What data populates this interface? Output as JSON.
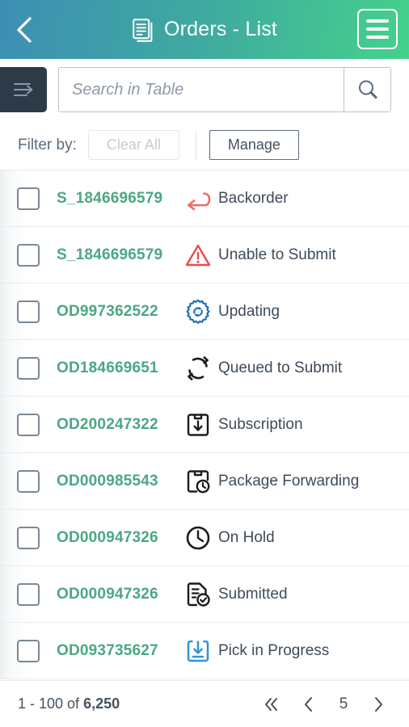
{
  "header": {
    "title": "Orders - List",
    "back_icon": "chevron-left-icon",
    "title_icon": "documents-icon",
    "menu_icon": "hamburger-menu-icon",
    "gradient_start": "#3d8fb4",
    "gradient_end": "#45d18c"
  },
  "toolbar": {
    "panel_toggle_icon": "expand-panel-icon",
    "search_placeholder": "Search in Table",
    "search_value": "",
    "search_icon": "search-icon"
  },
  "filters": {
    "label": "Filter by:",
    "clear_all_label": "Clear All",
    "clear_all_disabled": true,
    "manage_label": "Manage"
  },
  "list": {
    "rows": [
      {
        "order_id": "S_1846696579",
        "status": "Backorder",
        "icon": "backorder-arrow-icon",
        "icon_color": "#ef6b66"
      },
      {
        "order_id": "S_1846696579",
        "status": "Unable to Submit",
        "icon": "warning-triangle-icon",
        "icon_color": "#ef4a4a"
      },
      {
        "order_id": "OD997362522",
        "status": "Updating",
        "icon": "gear-refresh-icon",
        "icon_color": "#1c6cb5"
      },
      {
        "order_id": "OD184669651",
        "status": "Queued to Submit",
        "icon": "refresh-arrows-icon",
        "icon_color": "#1b1b1b"
      },
      {
        "order_id": "OD200247322",
        "status": "Subscription",
        "icon": "box-download-icon",
        "icon_color": "#1b1b1b"
      },
      {
        "order_id": "OD000985543",
        "status": "Package Forwarding",
        "icon": "box-clock-icon",
        "icon_color": "#1b1b1b"
      },
      {
        "order_id": "OD000947326",
        "status": "On Hold",
        "icon": "clock-icon",
        "icon_color": "#1b1b1b"
      },
      {
        "order_id": "OD000947326",
        "status": "Submitted",
        "icon": "document-check-icon",
        "icon_color": "#1b1b1b"
      },
      {
        "order_id": "OD093735627",
        "status": "Pick in Progress",
        "icon": "tray-download-icon",
        "icon_color": "#3195d6"
      }
    ],
    "order_id_color": "#4aa882"
  },
  "footer": {
    "count_prefix": "1 - 100 of ",
    "count_total": "6,250",
    "first_page_icon": "double-chevron-left-icon",
    "prev_page_icon": "chevron-left-icon",
    "current_page": "5",
    "next_page_icon": "chevron-right-icon"
  }
}
